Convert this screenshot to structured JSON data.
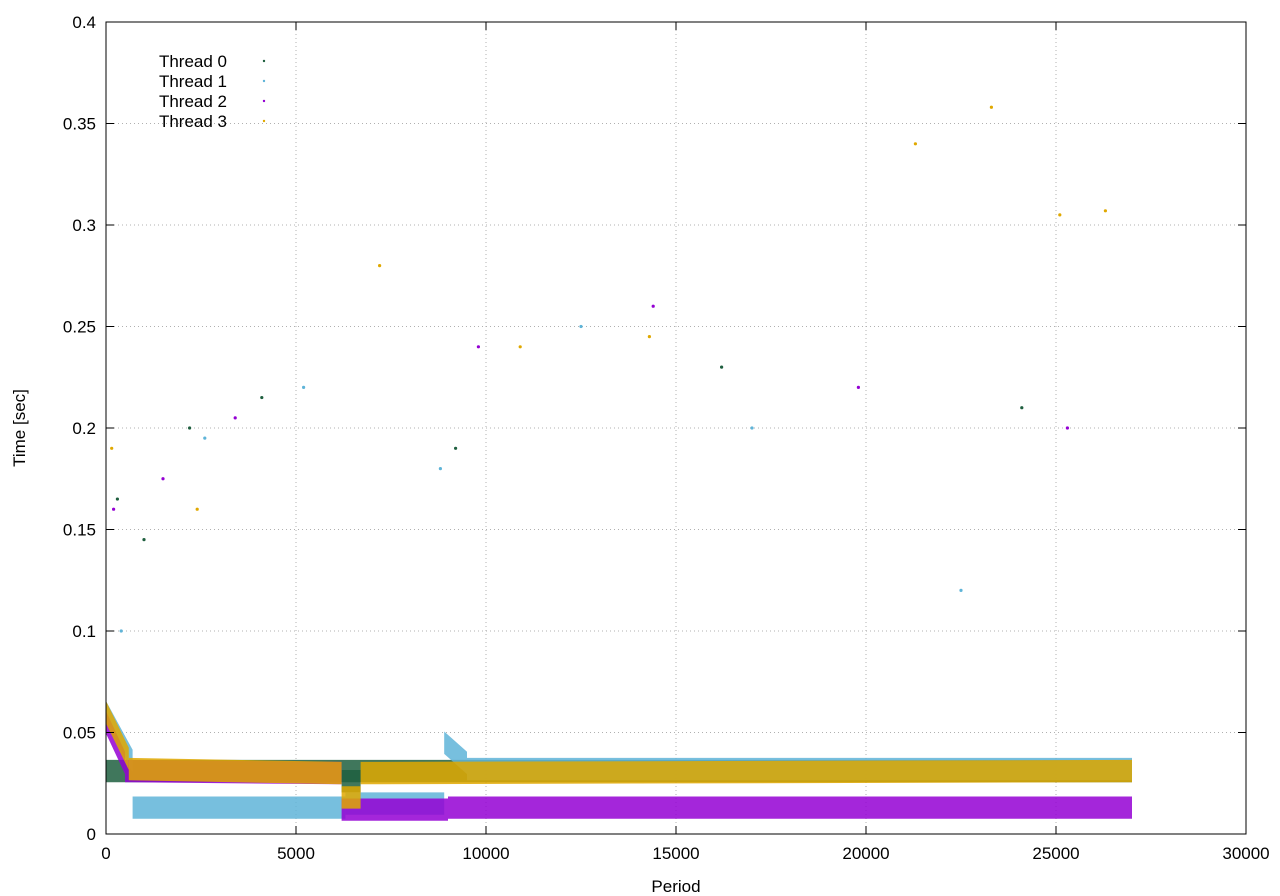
{
  "chart_data": {
    "type": "scatter",
    "title": "",
    "xlabel": "Period",
    "ylabel": "Time [sec]",
    "xlim": [
      0,
      30000
    ],
    "ylim": [
      0,
      0.4
    ],
    "x_ticks": [
      "0",
      "5000",
      "10000",
      "15000",
      "20000",
      "25000",
      "30000"
    ],
    "y_ticks": [
      "0",
      "0.05",
      "0.1",
      "0.15",
      "0.2",
      "0.25",
      "0.3",
      "0.35",
      "0.4"
    ],
    "x_tick_values": [
      0,
      5000,
      10000,
      15000,
      20000,
      25000,
      30000
    ],
    "y_tick_values": [
      0,
      0.05,
      0.1,
      0.15,
      0.2,
      0.25,
      0.3,
      0.35,
      0.4
    ],
    "grid": true,
    "legend_position": "top-left",
    "series": [
      {
        "name": "Thread 0",
        "color": "#1f5f3f",
        "segments": [
          {
            "x_start": 0,
            "x_end": 27000,
            "y_start": 0.031,
            "y_end": 0.031
          },
          {
            "x_start": 6200,
            "x_end": 6700,
            "y_start": 0.026,
            "y_end": 0.026
          }
        ],
        "outliers": [
          [
            300,
            0.165
          ],
          [
            1000,
            0.145
          ],
          [
            2200,
            0.2
          ],
          [
            4100,
            0.215
          ],
          [
            9200,
            0.19
          ],
          [
            16200,
            0.23
          ],
          [
            24100,
            0.21
          ]
        ]
      },
      {
        "name": "Thread 1",
        "color": "#5fb4d8",
        "segments": [
          {
            "x_start": 0,
            "x_end": 700,
            "y_start": 0.06,
            "y_end": 0.036
          },
          {
            "x_start": 700,
            "x_end": 6300,
            "y_start": 0.013,
            "y_end": 0.013
          },
          {
            "x_start": 6300,
            "x_end": 8900,
            "y_start": 0.015,
            "y_end": 0.015
          },
          {
            "x_start": 8900,
            "x_end": 9500,
            "y_start": 0.045,
            "y_end": 0.035
          },
          {
            "x_start": 9500,
            "x_end": 27000,
            "y_start": 0.032,
            "y_end": 0.032
          }
        ],
        "outliers": [
          [
            400,
            0.1
          ],
          [
            2600,
            0.195
          ],
          [
            5200,
            0.22
          ],
          [
            8800,
            0.18
          ],
          [
            12500,
            0.25
          ],
          [
            17000,
            0.2
          ],
          [
            22500,
            0.12
          ]
        ]
      },
      {
        "name": "Thread 2",
        "color": "#9400d3",
        "segments": [
          {
            "x_start": 0,
            "x_end": 500,
            "y_start": 0.055,
            "y_end": 0.035
          },
          {
            "x_start": 500,
            "x_end": 6200,
            "y_start": 0.031,
            "y_end": 0.03
          },
          {
            "x_start": 6200,
            "x_end": 9000,
            "y_start": 0.012,
            "y_end": 0.012
          },
          {
            "x_start": 9000,
            "x_end": 27000,
            "y_start": 0.013,
            "y_end": 0.013
          }
        ],
        "outliers": [
          [
            200,
            0.16
          ],
          [
            1500,
            0.175
          ],
          [
            3400,
            0.205
          ],
          [
            9800,
            0.24
          ],
          [
            14400,
            0.26
          ],
          [
            19800,
            0.22
          ],
          [
            25300,
            0.2
          ]
        ]
      },
      {
        "name": "Thread 3",
        "color": "#e0a800",
        "segments": [
          {
            "x_start": 0,
            "x_end": 600,
            "y_start": 0.06,
            "y_end": 0.037
          },
          {
            "x_start": 600,
            "x_end": 6200,
            "y_start": 0.032,
            "y_end": 0.03
          },
          {
            "x_start": 6200,
            "x_end": 6700,
            "y_start": 0.018,
            "y_end": 0.018
          },
          {
            "x_start": 6700,
            "x_end": 27000,
            "y_start": 0.03,
            "y_end": 0.031
          }
        ],
        "outliers": [
          [
            150,
            0.19
          ],
          [
            2400,
            0.16
          ],
          [
            7200,
            0.28
          ],
          [
            10900,
            0.24
          ],
          [
            14300,
            0.245
          ],
          [
            21300,
            0.34
          ],
          [
            23300,
            0.358
          ],
          [
            25100,
            0.305
          ],
          [
            26300,
            0.307
          ]
        ]
      }
    ]
  }
}
